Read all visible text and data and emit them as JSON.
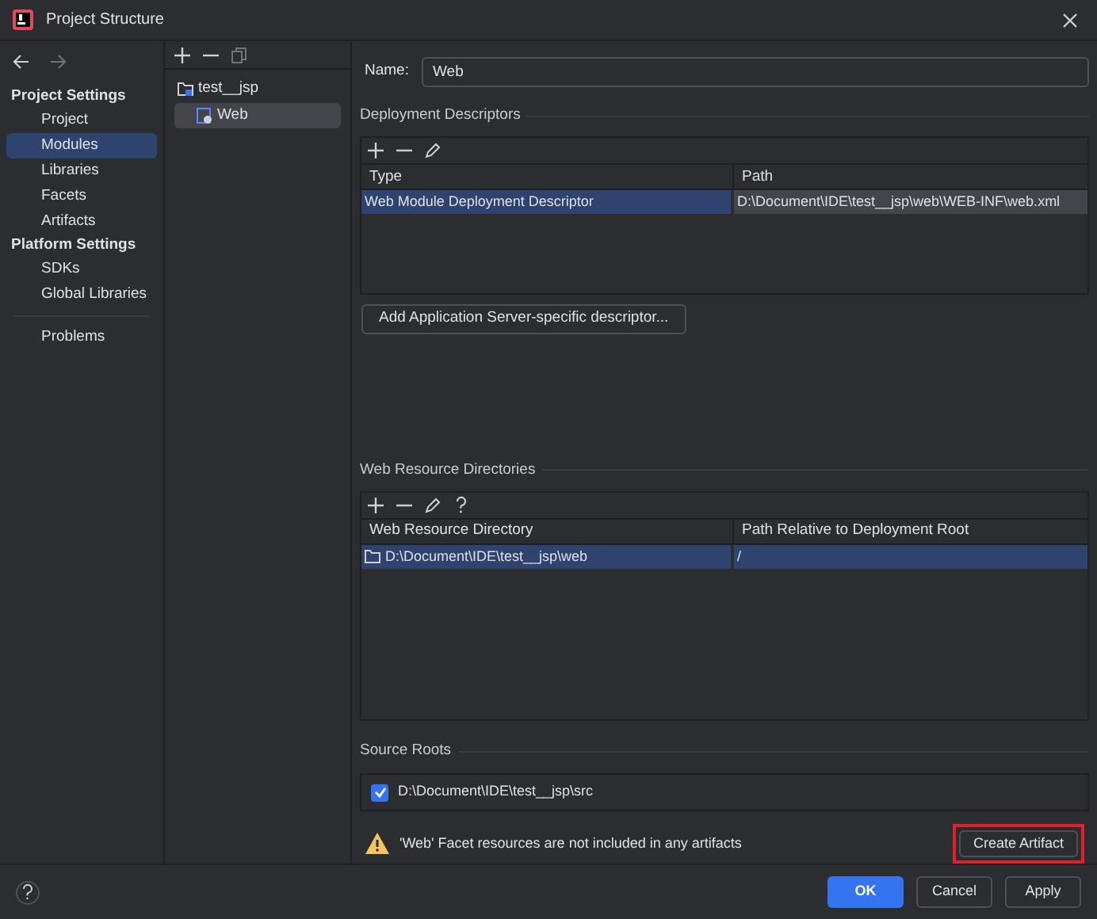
{
  "window": {
    "title": "Project Structure"
  },
  "sidebar": {
    "sections": [
      {
        "heading": "Project Settings",
        "items": [
          {
            "label": "Project",
            "selected": false
          },
          {
            "label": "Modules",
            "selected": true
          },
          {
            "label": "Libraries",
            "selected": false
          },
          {
            "label": "Facets",
            "selected": false
          },
          {
            "label": "Artifacts",
            "selected": false
          }
        ]
      },
      {
        "heading": "Platform Settings",
        "items": [
          {
            "label": "SDKs",
            "selected": false
          },
          {
            "label": "Global Libraries",
            "selected": false
          }
        ]
      }
    ],
    "extra_items": [
      {
        "label": "Problems",
        "selected": false
      }
    ]
  },
  "module_tree": [
    {
      "label": "test__jsp",
      "kind": "folder",
      "selected": false,
      "children": [
        {
          "label": "Web",
          "kind": "web",
          "selected": true
        }
      ]
    }
  ],
  "name_field": {
    "label": "Name:",
    "value": "Web"
  },
  "deployment_descriptors": {
    "title": "Deployment Descriptors",
    "columns": [
      "Type",
      "Path"
    ],
    "rows": [
      {
        "cells": [
          "Web Module Deployment Descriptor",
          "D:\\Document\\IDE\\test__jsp\\web\\WEB-INF\\web.xml"
        ],
        "selected": true
      }
    ],
    "button": "Add Application Server-specific descriptor..."
  },
  "web_resource_directories": {
    "title": "Web Resource Directories",
    "columns": [
      "Web Resource Directory",
      "Path Relative to Deployment Root"
    ],
    "rows": [
      {
        "cells": [
          "D:\\Document\\IDE\\test__jsp\\web",
          "/"
        ],
        "selected": true
      }
    ]
  },
  "source_roots": {
    "title": "Source Roots",
    "items": [
      {
        "label": "D:\\Document\\IDE\\test__jsp\\src",
        "checked": true
      }
    ]
  },
  "warning": {
    "text": "'Web' Facet resources are not included in any artifacts",
    "button": "Create Artifact",
    "highlighted": true
  },
  "footer": {
    "buttons": [
      {
        "label": "OK",
        "kind": "primary"
      },
      {
        "label": "Cancel",
        "kind": "secondary"
      },
      {
        "label": "Apply",
        "kind": "secondary"
      }
    ]
  }
}
